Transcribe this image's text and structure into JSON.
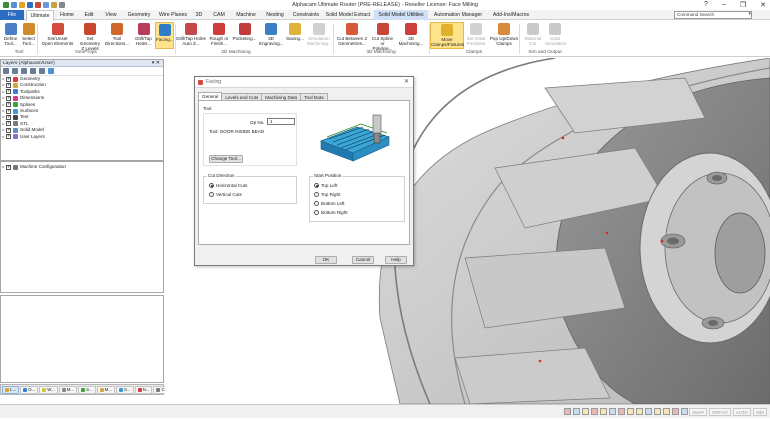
{
  "app": {
    "title": "Alphacam Ultimate Router (PRE-RELEASE) - Reseller License: Face Milling",
    "window_controls": [
      "?",
      "–",
      "❐",
      "✕"
    ],
    "qat_colors": [
      "#3d8b3d",
      "#5a8fd0",
      "#e0a42d",
      "#2f6fbd",
      "#c14d3a",
      "#6a9bd6",
      "#c9a24a",
      "#888888"
    ]
  },
  "ribbon": {
    "tabs": [
      "File",
      "Ultimate",
      "Home",
      "Edit",
      "View",
      "Geometry",
      "Wire Planes",
      "3D",
      "CAM",
      "Machine",
      "Nesting",
      "Constraints",
      "Solid Model Extract",
      "Solid Model Utilities",
      "Automation Manager",
      "Add-Ins/Macros"
    ],
    "active_tab": "Ultimate",
    "search_placeholder": "Command Search",
    "buttons": [
      {
        "label1": "Define",
        "label2": "Tool...",
        "color": "#4a7fc7"
      },
      {
        "label1": "Select",
        "label2": "Tool...",
        "color": "#cf8a2c"
      },
      {
        "label1": "Set/Unset",
        "label2": "Open Elements",
        "color": "#d24b3c"
      },
      {
        "label1": "Set Geometry",
        "label2": "Z Levels",
        "color": "#c9472f"
      },
      {
        "label1": "Tool",
        "label2": "Directions...",
        "color": "#d0672d"
      },
      {
        "label1": "Drill/Tap",
        "label2": "Holes...",
        "color": "#b93b5c"
      },
      {
        "label1": "Facing...",
        "label2": "",
        "color": "#2f7dc7"
      },
      {
        "label1": "Drill/Tap Holes",
        "label2": "Auto Z...",
        "color": "#c44848"
      },
      {
        "label1": "Rough or",
        "label2": "Finish...",
        "color": "#cf3c3c"
      },
      {
        "label1": "Pocketing...",
        "label2": "",
        "color": "#c23a3a"
      },
      {
        "label1": "3D",
        "label2": "Engraving...",
        "color": "#3d7fc4"
      },
      {
        "label1": "Saving...",
        "label2": "",
        "color": "#e0b43a"
      },
      {
        "label1": "Simulation",
        "label2": "Machining...",
        "color": "#9a9a9a"
      },
      {
        "label1": "Cut Between 2",
        "label2": "Geometries...",
        "color": "#d65a3a"
      },
      {
        "label1": "Cut Spline or",
        "label2": "Polyline...",
        "color": "#c8473a"
      },
      {
        "label1": "3D",
        "label2": "Machining...",
        "color": "#cc3f3f"
      },
      {
        "label1": "Move",
        "label2": "Clamps/Fixtures",
        "color": "#e0b12e"
      },
      {
        "label1": "Set Initial",
        "label2": "Positions",
        "color": "#9a9a9a"
      },
      {
        "label1": "Pop Up/Down",
        "label2": "Clamps",
        "color": "#d8893a"
      },
      {
        "label1": "Material",
        "label2": "Cut",
        "color": "#8a8a8a"
      },
      {
        "label1": "Solid",
        "label2": "Simulation",
        "color": "#8a8a8a"
      }
    ],
    "groups": [
      "Tool",
      "GeoProps",
      "2D Machining",
      "3D Machining",
      "Clamps",
      "Sim and Output"
    ]
  },
  "layers_panel": {
    "title": "Layers (Alphacam/User)",
    "head_buttons": "▾ ✕",
    "items": [
      {
        "label": "Geometry",
        "color": "#d63a3a"
      },
      {
        "label": "Construction",
        "color": "#d6a63a"
      },
      {
        "label": "Toolpaths",
        "color": "#3a7fd6"
      },
      {
        "label": "Dimensions",
        "color": "#d63a8a"
      },
      {
        "label": "Splines",
        "color": "#3aa63a"
      },
      {
        "label": "Surfaces",
        "color": "#3a9ad6"
      },
      {
        "label": "Text",
        "color": "#444444"
      },
      {
        "label": "STL",
        "color": "#7a7a7a"
      },
      {
        "label": "Solid Model",
        "color": "#6a8ab6"
      },
      {
        "label": "User Layers",
        "color": "#8a6ad6"
      }
    ]
  },
  "machine_panel": {
    "item": "Machine Configuration"
  },
  "bottom_tabs": [
    {
      "label": "L...",
      "color": "#d6a63a"
    },
    {
      "label": "O...",
      "color": "#3a7fd6"
    },
    {
      "label": "W...",
      "color": "#d6c43a"
    },
    {
      "label": "M...",
      "color": "#888888"
    },
    {
      "label": "S...",
      "color": "#3aa63a"
    },
    {
      "label": "M...",
      "color": "#d6a63a"
    },
    {
      "label": "S...",
      "color": "#3a9ad6"
    },
    {
      "label": "N...",
      "color": "#d63a3a"
    },
    {
      "label": "C...",
      "color": "#7a7a7a"
    }
  ],
  "status": {
    "modes": [
      "SNAP",
      "ORTHO",
      "AUTO",
      "MDI"
    ]
  },
  "dialog": {
    "title": "Facing",
    "close": "✕",
    "tabs": [
      "General",
      "Levels and Cuts",
      "Machining Data",
      "Tool Data"
    ],
    "active_tab": "General",
    "tool_group": "Tool",
    "op_no_label": "Op No.",
    "op_no_value": "1",
    "tool_text": "Tool: DOOR INSIDE BEAD",
    "change_tool": "Change Tool...",
    "cut_direction_label": "Cut Direction",
    "cut_direction_options": [
      "Horizontal Cuts",
      "Vertical Cuts"
    ],
    "cut_direction_selected": 0,
    "start_position_label": "Start Position",
    "start_position_options": [
      "Top Left",
      "Top Right",
      "Bottom Left",
      "Bottom Right"
    ],
    "start_position_selected": 0,
    "ok": "OK",
    "cancel": "Cancel",
    "help": "Help"
  }
}
